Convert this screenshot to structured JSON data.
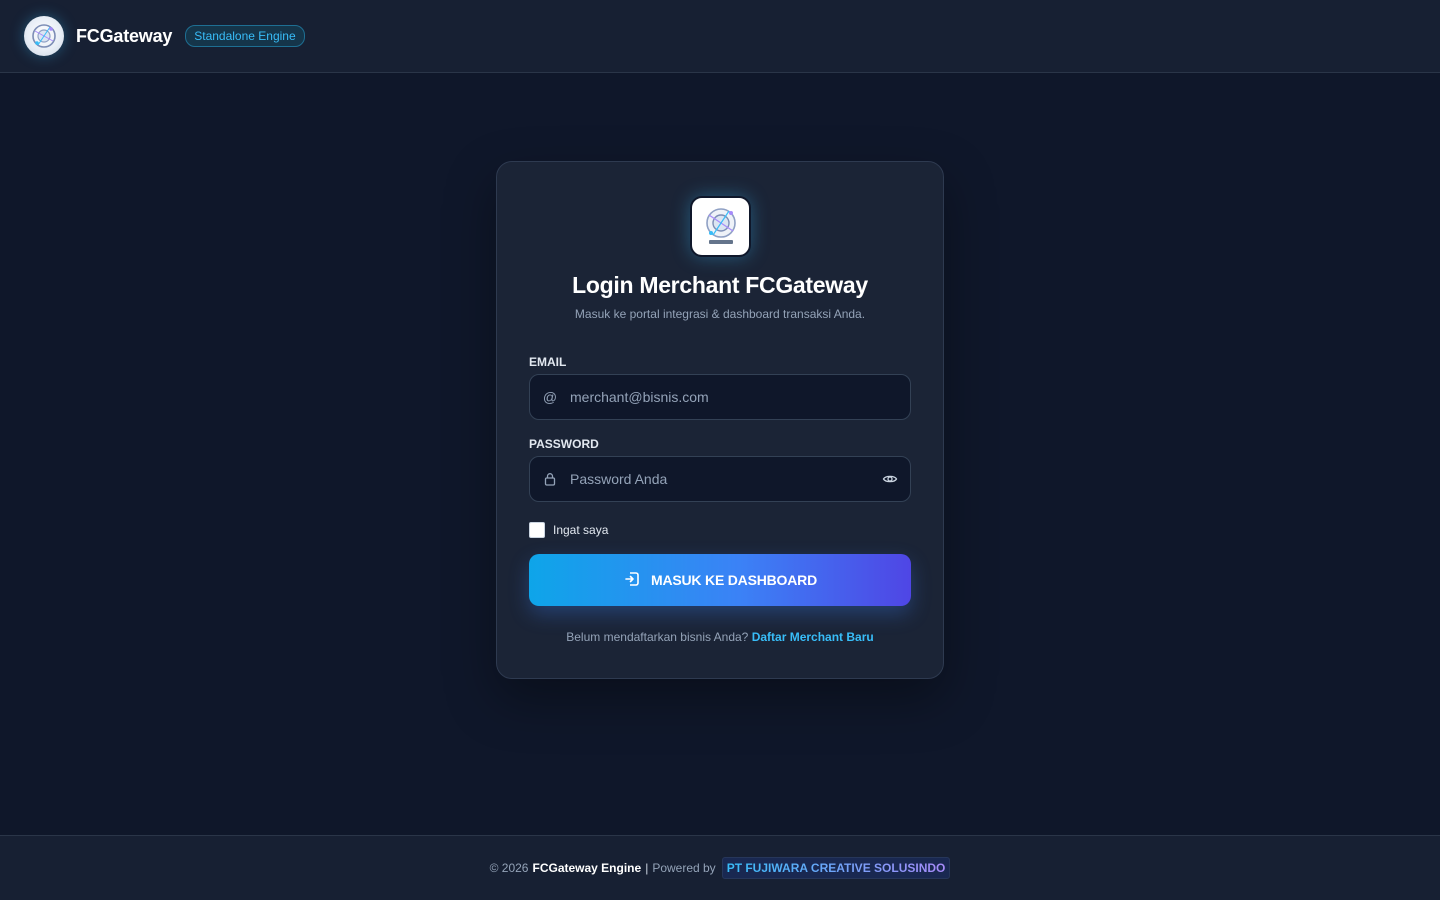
{
  "header": {
    "brand_name": "FCGateway",
    "badge": "Standalone Engine"
  },
  "login": {
    "title": "Login Merchant FCGateway",
    "subtitle": "Masuk ke portal integrasi & dashboard transaksi Anda.",
    "email_label": "EMAIL",
    "email_placeholder": "merchant@bisnis.com",
    "password_label": "PASSWORD",
    "password_placeholder": "Password Anda",
    "remember_label": "Ingat saya",
    "submit_label": "MASUK KE DASHBOARD",
    "signup_prompt": "Belum mendaftarkan bisnis Anda?",
    "signup_link": "Daftar Merchant Baru"
  },
  "footer": {
    "copyright": "© 2026",
    "engine": "FCGateway Engine",
    "separator": "|",
    "powered_by": "Powered by",
    "company": "PT FUJIWARA CREATIVE SOLUSINDO"
  },
  "colors": {
    "background": "#0f172a",
    "card": "#1b2436",
    "accent": "#38bdf8",
    "button_start": "#0ea5e9",
    "button_end": "#4f46e5"
  },
  "icons": {
    "brand": "fcgateway-logo-icon",
    "email": "at-sign-icon",
    "password": "lock-icon",
    "toggle_password": "eye-icon",
    "submit": "login-icon"
  }
}
